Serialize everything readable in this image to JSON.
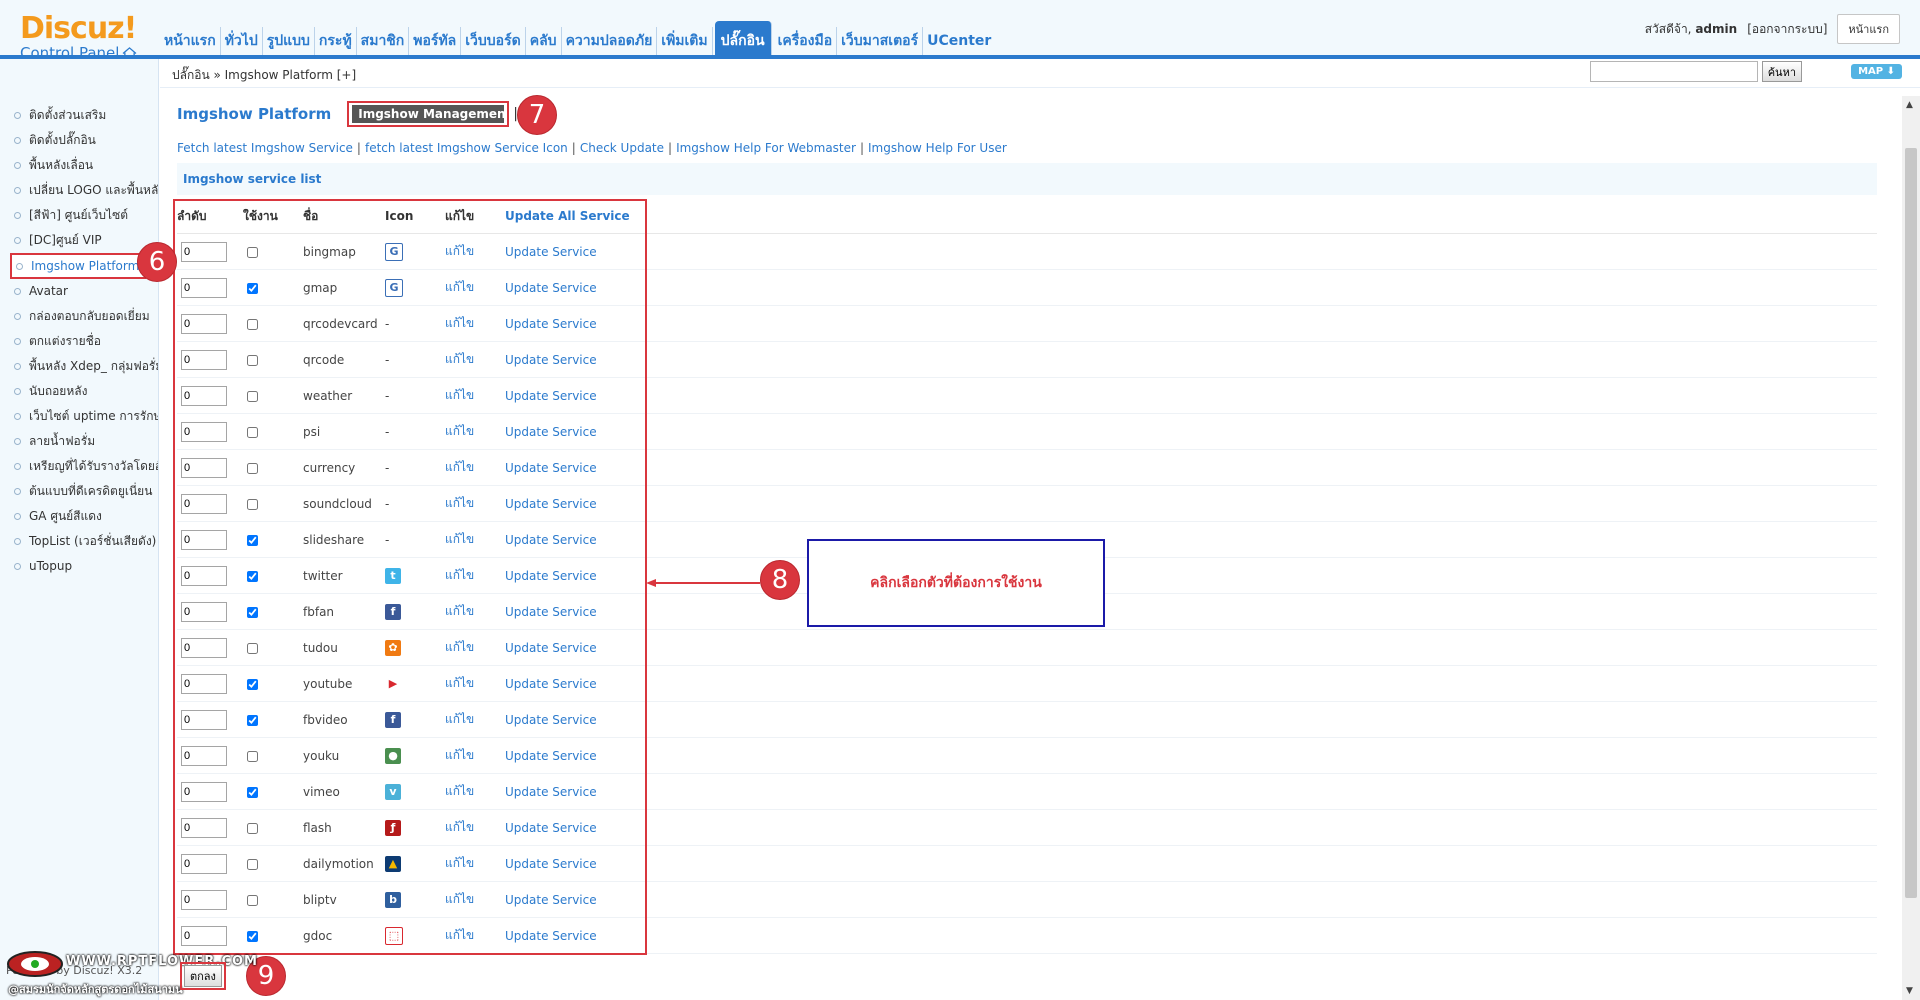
{
  "logo": {
    "brand": "Discuz!",
    "sub": "Control Panel"
  },
  "nav": [
    "หน้าแรก",
    "ทั่วไป",
    "รูปแบบ",
    "กระทู้",
    "สมาชิก",
    "พอร์ทัล",
    "เว็บบอร์ด",
    "คลับ",
    "ความปลอดภัย",
    "เพิ่มเติม",
    "ปลั๊กอิน",
    "เครื่องมือ",
    "เว็บมาสเตอร์",
    "UCenter"
  ],
  "nav_active_index": 10,
  "user": {
    "greeting": "สวัสดีจ้า,",
    "name": "admin",
    "logout": "[ออกจากระบบ]",
    "home_button": "หน้าแรก"
  },
  "breadcrumb": "ปลั๊กอิน » Imgshow Platform  [+]",
  "search": {
    "value": "",
    "button": "ค้นหา",
    "map": "MAP"
  },
  "sidebar": [
    "ติดตั้งส่วนเสริม",
    "ติดตั้งปลั๊กอิน",
    "พื้นหลังเลื่อน",
    "เปลี่ยน LOGO และพื้นหลัง",
    "[สีฟ้า] ศูนย์เว็บไซต์",
    "[DC]ศูนย์ VIP",
    "Imgshow Platform",
    "Avatar",
    "กล่องตอบกลับยอดเยี่ยม",
    "ตกแต่งรายชื่อ",
    "พื้นหลัง Xdep_ กลุ่มฟอรั่ม",
    "นับถอยหลัง",
    "เว็บไซต์ uptime การรักษา",
    "ลายน้ำฟอรั่ม",
    "เหรียญที่ได้รับรางวัลโดยอัตโนมัติ",
    "ต้นแบบที่ดีเครดิตยูเนี่ยน",
    "GA ศูนย์สีแดง",
    "TopList (เวอร์ชั่นเสียดัง)",
    "uTopup"
  ],
  "sidebar_active_index": 6,
  "main": {
    "title": "Imgshow Platform",
    "tab": "Imgshow Management",
    "tab_sep": "|",
    "links": [
      "Fetch latest Imgshow Service",
      "fetch latest Imgshow Service Icon",
      "Check Update",
      "Imgshow Help For Webmaster",
      "Imgshow Help For User"
    ],
    "section": "Imgshow service list",
    "columns": {
      "order": "ลำดับ",
      "enable": "ใช้งาน",
      "name": "ชื่อ",
      "icon": "Icon",
      "edit": "แก้ไข",
      "update_all": "Update All Service"
    },
    "row_edit": "แก้ไข",
    "row_update": "Update Service",
    "services": [
      {
        "order": "0",
        "enabled": false,
        "name": "bingmap",
        "icon": "google-icon"
      },
      {
        "order": "0",
        "enabled": true,
        "name": "gmap",
        "icon": "google-icon"
      },
      {
        "order": "0",
        "enabled": false,
        "name": "qrcodevcard",
        "icon": "-"
      },
      {
        "order": "0",
        "enabled": false,
        "name": "qrcode",
        "icon": "-"
      },
      {
        "order": "0",
        "enabled": false,
        "name": "weather",
        "icon": "-"
      },
      {
        "order": "0",
        "enabled": false,
        "name": "psi",
        "icon": "-"
      },
      {
        "order": "0",
        "enabled": false,
        "name": "currency",
        "icon": "-"
      },
      {
        "order": "0",
        "enabled": false,
        "name": "soundcloud",
        "icon": "-"
      },
      {
        "order": "0",
        "enabled": true,
        "name": "slideshare",
        "icon": "-"
      },
      {
        "order": "0",
        "enabled": true,
        "name": "twitter",
        "icon": "twitter-icon"
      },
      {
        "order": "0",
        "enabled": true,
        "name": "fbfan",
        "icon": "facebook-icon"
      },
      {
        "order": "0",
        "enabled": false,
        "name": "tudou",
        "icon": "tudou-icon"
      },
      {
        "order": "0",
        "enabled": true,
        "name": "youtube",
        "icon": "youtube-icon"
      },
      {
        "order": "0",
        "enabled": true,
        "name": "fbvideo",
        "icon": "facebook-icon"
      },
      {
        "order": "0",
        "enabled": false,
        "name": "youku",
        "icon": "youku-icon"
      },
      {
        "order": "0",
        "enabled": true,
        "name": "vimeo",
        "icon": "vimeo-icon"
      },
      {
        "order": "0",
        "enabled": false,
        "name": "flash",
        "icon": "flash-icon"
      },
      {
        "order": "0",
        "enabled": false,
        "name": "dailymotion",
        "icon": "dailymotion-icon"
      },
      {
        "order": "0",
        "enabled": false,
        "name": "bliptv",
        "icon": "bliptv-icon"
      },
      {
        "order": "0",
        "enabled": true,
        "name": "gdoc",
        "icon": "pdf-icon"
      }
    ],
    "submit": "ตกลง"
  },
  "annotations": {
    "b6": "6",
    "b7": "7",
    "b8": "8",
    "b9": "9",
    "note": "คลิกเลือกตัวที่ต้องการใช้งาน"
  },
  "footer": "Powered by Discuz! X3.2",
  "watermark": {
    "line1": "WWW.RPTFLOWER.COM",
    "line2": "@สมรมนักจัดหลักสูตรดอกไม้สนามน"
  },
  "colors": {
    "accent": "#2b7acd",
    "logo": "#f49a1d",
    "annotation": "#d9363e",
    "note_border": "#1b1aa8"
  }
}
